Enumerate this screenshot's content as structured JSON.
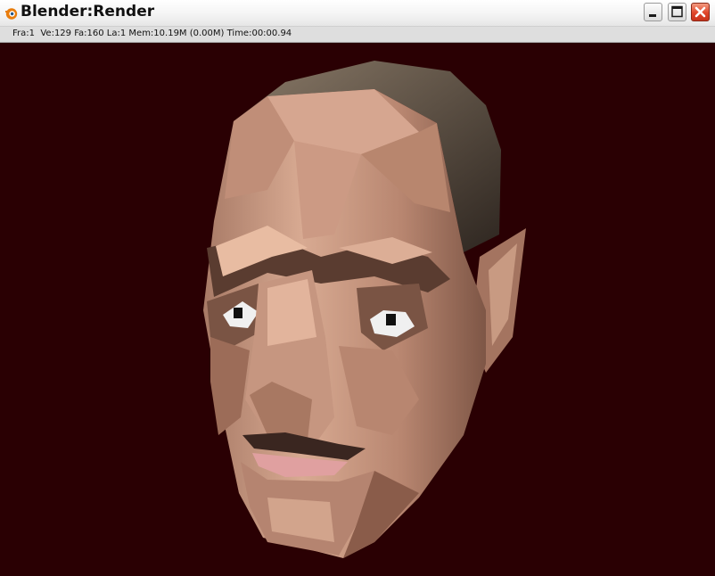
{
  "window": {
    "title": "Blender:Render",
    "controls": {
      "minimize": "minimize-icon",
      "maximize": "maximize-icon",
      "close": "close-icon"
    }
  },
  "status": {
    "text": "Fra:1  Ve:129 Fa:160 La:1 Mem:10.19M (0.00M) Time:00:00.94"
  },
  "render": {
    "background_color": "#2a0003",
    "skin_color": "#c49480",
    "hair_color": "#4a4036",
    "lip_color": "#e0a0a0"
  }
}
